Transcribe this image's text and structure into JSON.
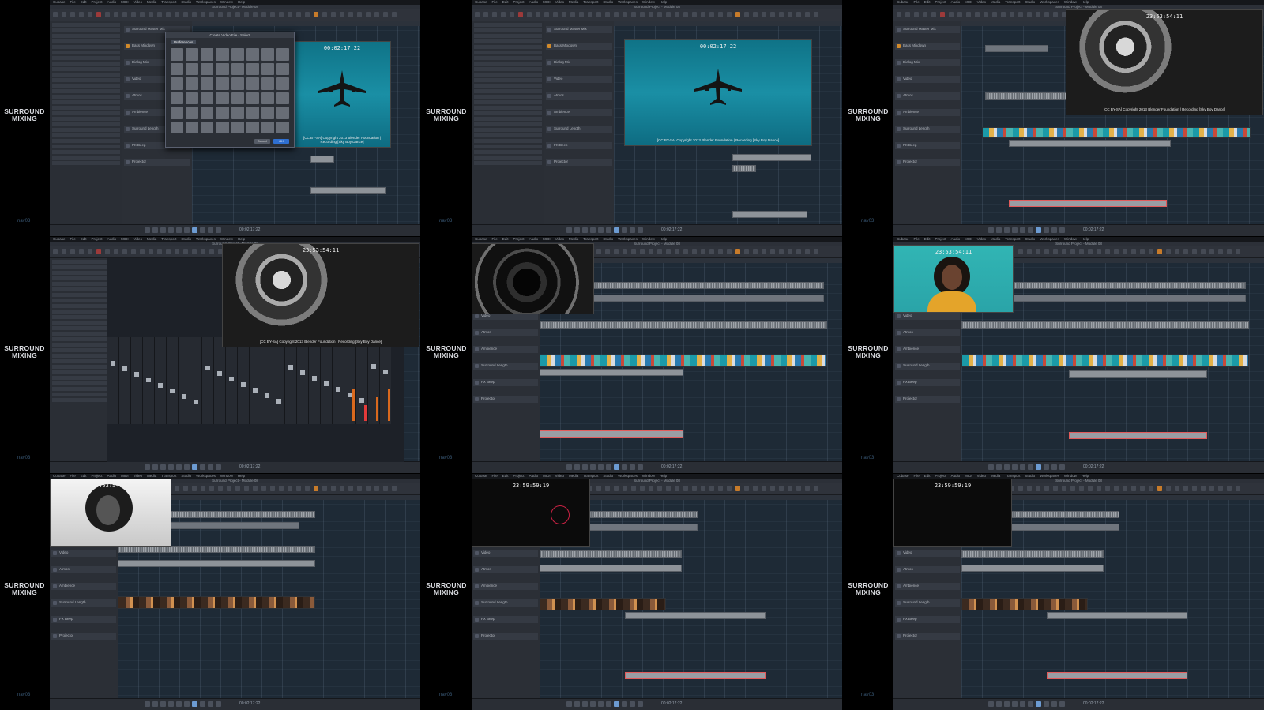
{
  "side_panel": {
    "title": "SURROUND\nMIXING",
    "footer": "nav03"
  },
  "app": {
    "menu_items": [
      "Cubase",
      "File",
      "Edit",
      "Project",
      "Audio",
      "MIDI",
      "Video",
      "Media",
      "Transport",
      "Studio",
      "Workspaces",
      "Window",
      "Help"
    ],
    "window_title": "Surround Project - Module 08",
    "transport_time": "00:02:17:22"
  },
  "tracks": [
    {
      "name": "Surround Master Mix",
      "color": "gray"
    },
    {
      "name": "Bass Mixdown",
      "color": "orange"
    },
    {
      "name": "Dialog Mix",
      "color": "gray"
    },
    {
      "name": "Video",
      "color": "gray"
    },
    {
      "name": "Atmos",
      "color": "gray"
    },
    {
      "name": "Ambience",
      "color": "gray"
    },
    {
      "name": "Surround Length",
      "color": "gray"
    },
    {
      "name": "FX Beep",
      "color": "gray"
    },
    {
      "name": "Projector",
      "color": "gray"
    }
  ],
  "video_windows": {
    "plane_timecode": "00:02:17:22",
    "projector_timecode": "23:53:54:11",
    "dark_timecode": "23:59:59:19",
    "subtitle": "[CC BY-SA] Copyright 2013 Blender Foundation | Recording [Sky Boy Dance]"
  },
  "dialog": {
    "title": "Create Video File / Select",
    "tab": "Preferences",
    "cancel_label": "Cancel",
    "ok_label": "OK"
  },
  "cells": [
    {
      "id": "cell-1",
      "scene": "plane-with-dialog"
    },
    {
      "id": "cell-2",
      "scene": "plane-video"
    },
    {
      "id": "cell-3",
      "scene": "projector-timeline"
    },
    {
      "id": "cell-4",
      "scene": "projector-mixer"
    },
    {
      "id": "cell-5",
      "scene": "lens-timeline"
    },
    {
      "id": "cell-6",
      "scene": "portrait-teal-timeline"
    },
    {
      "id": "cell-7",
      "scene": "portrait-bw-timeline"
    },
    {
      "id": "cell-8",
      "scene": "dark-frame-cursor"
    },
    {
      "id": "cell-9",
      "scene": "dark-frame-timeline"
    }
  ]
}
